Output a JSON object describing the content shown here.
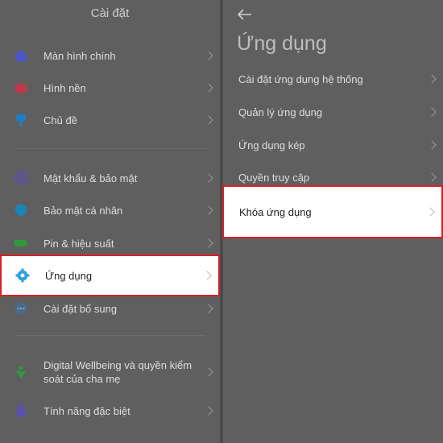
{
  "left": {
    "title": "Cài đặt",
    "items": [
      {
        "label": "Màn hình chính",
        "icon": "home-icon",
        "color": "#4a55c8"
      },
      {
        "label": "Hình nền",
        "icon": "wallpaper-icon",
        "color": "#c0394b"
      },
      {
        "label": "Chủ đề",
        "icon": "theme-brush-icon",
        "color": "#1e7fc4"
      },
      {
        "label": "Mật khẩu & bảo mật",
        "icon": "fingerprint-icon",
        "color": "#5a4fb0"
      },
      {
        "label": "Bảo mật cá nhân",
        "icon": "privacy-shield-icon",
        "color": "#1f83b8"
      },
      {
        "label": "Pin & hiệu suất",
        "icon": "battery-icon",
        "color": "#2f9a3a"
      },
      {
        "label": "Ứng dụng",
        "icon": "gear-icon",
        "color": "#2ea0e0"
      },
      {
        "label": "Cài đặt bổ sung",
        "icon": "more-dots-icon",
        "color": "#4a6a8a"
      },
      {
        "label": "Digital Wellbeing và quyền kiểm soát của cha mẹ",
        "icon": "wellbeing-icon",
        "color": "#2f9a3a"
      },
      {
        "label": "Tính năng đặc biệt",
        "icon": "special-features-icon",
        "color": "#5a4fb0"
      }
    ]
  },
  "right": {
    "title": "Ứng dụng",
    "items": [
      {
        "label": "Cài đặt ứng dụng hệ thống"
      },
      {
        "label": "Quản lý ứng dụng"
      },
      {
        "label": "Ứng dụng kép"
      },
      {
        "label": "Quyền truy cập"
      },
      {
        "label": "Khóa ứng dụng"
      }
    ]
  },
  "colors": {
    "highlight_border": "#d8202a",
    "dim_overlay": "#5f5f5f"
  }
}
